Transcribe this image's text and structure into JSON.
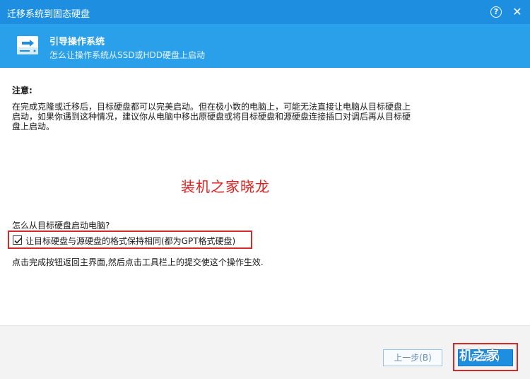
{
  "window": {
    "title": "迁移系统到固态硬盘",
    "help_glyph": "?",
    "close_glyph": "✕"
  },
  "header": {
    "icon": "disk-drive-icon",
    "title": "引导操作系统",
    "subtitle": "怎么让操作系统从SSD或HDD硬盘上启动"
  },
  "content": {
    "note_title": "注意:",
    "note_body": "在完成克隆或迁移后，目标硬盘都可以完美启动。但在极小数的电脑上，可能无法直接让电脑从目标硬盘上启动，如果你遇到这种情况，建议你从电脑中移出原硬盘或将目标硬盘和源硬盘连接插口对调后再从目标硬盘上启动。",
    "watermark": "装机之家晓龙",
    "question": "怎么从目标硬盘启动电脑?",
    "option_label": "让目标硬盘与源硬盘的格式保持相同(都为GPT格式硬盘)",
    "option_checked": true,
    "hint": "点击完成按钮返回主界面,然后点击工具栏上的提交使这个操作生效."
  },
  "footer": {
    "prev_label": "上一步(B)",
    "finish_label": "完成(F)",
    "logo_text": "机之家"
  },
  "colors": {
    "titlebar": "#1e8fe0",
    "header": "#2aa0ea",
    "highlight": "#d42a2a",
    "watermark": "#e01f1f"
  }
}
